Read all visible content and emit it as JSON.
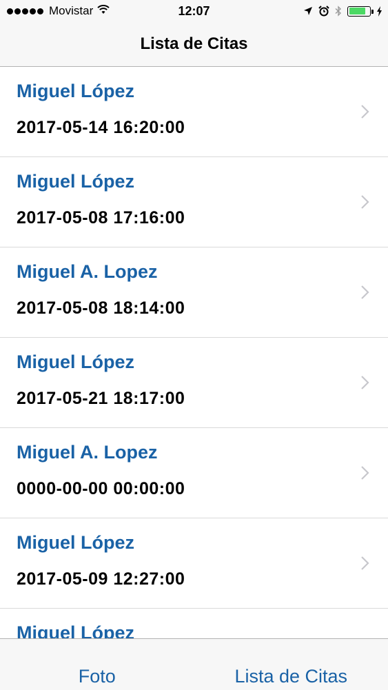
{
  "status_bar": {
    "carrier": "Movistar",
    "time": "12:07",
    "icons": [
      "signal-dots-icon",
      "wifi-icon",
      "location-arrow-icon",
      "alarm-icon",
      "bluetooth-icon",
      "battery-icon",
      "charging-bolt-icon"
    ],
    "battery_level": 0.8,
    "battery_color": "#4cd964"
  },
  "nav": {
    "title": "Lista de Citas"
  },
  "list": {
    "items": [
      {
        "name": "Miguel López",
        "date": "2017-05-14 16:20:00"
      },
      {
        "name": "Miguel López",
        "date": "2017-05-08 17:16:00"
      },
      {
        "name": "Miguel A. Lopez",
        "date": "2017-05-08 18:14:00"
      },
      {
        "name": "Miguel López",
        "date": "2017-05-21 18:17:00"
      },
      {
        "name": "Miguel A. Lopez",
        "date": "0000-00-00 00:00:00"
      },
      {
        "name": "Miguel López",
        "date": "2017-05-09 12:27:00"
      },
      {
        "name": "Miguel López",
        "date": ""
      }
    ]
  },
  "tabs": [
    {
      "label": "Foto"
    },
    {
      "label": "Lista de Citas"
    }
  ],
  "colors": {
    "accent": "#1a62a6",
    "bar_background": "#f7f7f7",
    "separator": "#d9d9d9"
  }
}
